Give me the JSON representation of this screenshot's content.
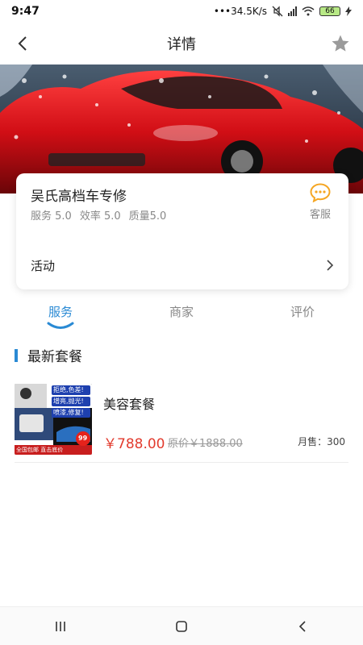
{
  "status_bar": {
    "time": "9:47",
    "network_speed": "•••34.5K/s",
    "signal": "4G",
    "battery": "66"
  },
  "nav": {
    "title": "详情",
    "back_icon": "chevron-left-icon",
    "favorite_icon": "star-icon"
  },
  "shop": {
    "name": "吴氏高档车专修",
    "ratings": [
      {
        "label": "服务 5.0"
      },
      {
        "label": "效率 5.0"
      },
      {
        "label": "质量5.0"
      }
    ],
    "service_label": "客服",
    "activity_label": "活动"
  },
  "tabs": [
    {
      "label": "服务",
      "active": true
    },
    {
      "label": "商家",
      "active": false
    },
    {
      "label": "评价",
      "active": false
    }
  ],
  "section": {
    "title": "最新套餐"
  },
  "packages": [
    {
      "name": "美容套餐",
      "price": "￥788.00",
      "original_price": "原价￥1888.00",
      "sales": "月售：300",
      "thumb_text": {
        "line1": "拒绝,色差!",
        "line2": "增亮,抛光!",
        "line3": "喷漆,修复!",
        "bottom": "全国包邮 直击底价",
        "badge": "99"
      }
    }
  ],
  "colors": {
    "accent": "#2a8ad4",
    "price": "#e23b2e",
    "service_icon": "#f5a623"
  }
}
